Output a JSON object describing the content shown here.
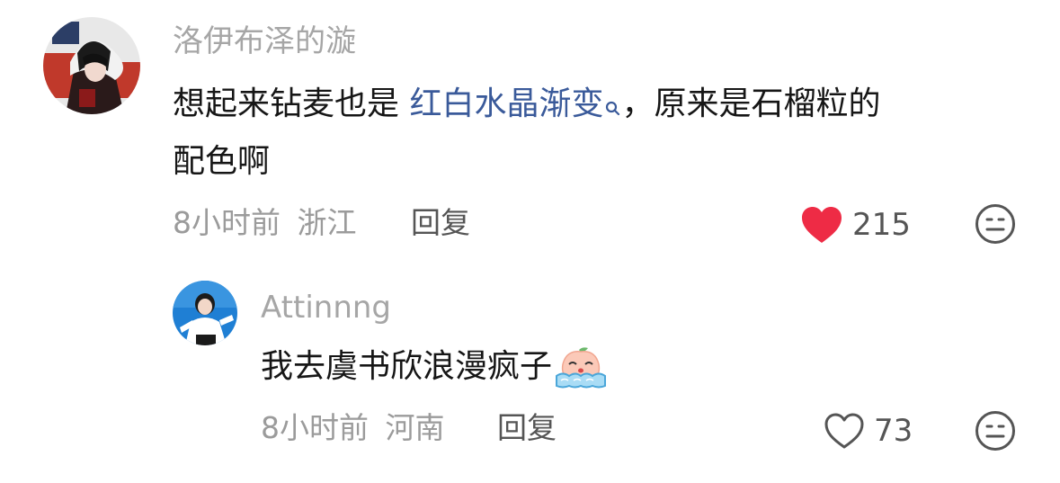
{
  "comments": [
    {
      "username": "洛伊布泽的漩",
      "text_before": "想起来钻麦也是 ",
      "link_text": "红白水晶渐变",
      "link_icon": "search-icon",
      "text_after_line1": "，原来是石榴粒的",
      "text_line2": "配色啊",
      "time": "8小时前",
      "location": "浙江",
      "reply_label": "回复",
      "like_count": "215",
      "liked": true,
      "like_color": "#ee2b45"
    },
    {
      "username": "Attinnng",
      "text": "我去虞书欣浪漫疯子",
      "emoji": "crying-peach-emoji",
      "time": "8小时前",
      "location": "河南",
      "reply_label": "回复",
      "like_count": "73",
      "liked": false
    }
  ],
  "icons": {
    "like": "heart-icon",
    "dislike": "meh-face-icon"
  }
}
